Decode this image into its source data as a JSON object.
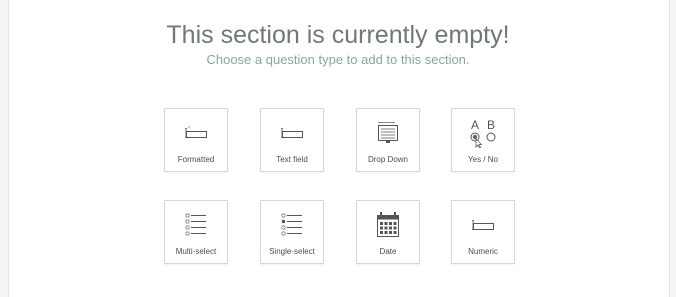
{
  "empty_state": {
    "title": "This section is currently empty!",
    "subtitle": "Choose a question type to add to this section."
  },
  "question_types": [
    {
      "label": "Formatted",
      "icon": "formatted-field-icon"
    },
    {
      "label": "Text field",
      "icon": "text-field-icon"
    },
    {
      "label": "Drop Down",
      "icon": "dropdown-list-icon"
    },
    {
      "label": "Yes / No",
      "icon": "yes-no-radio-icon",
      "icon_text_a": "A",
      "icon_text_b": "B"
    },
    {
      "label": "Multi-select",
      "icon": "checkbox-list-icon"
    },
    {
      "label": "Single-select",
      "icon": "radio-list-icon"
    },
    {
      "label": "Date",
      "icon": "calendar-icon"
    },
    {
      "label": "Numeric",
      "icon": "numeric-field-icon"
    }
  ]
}
